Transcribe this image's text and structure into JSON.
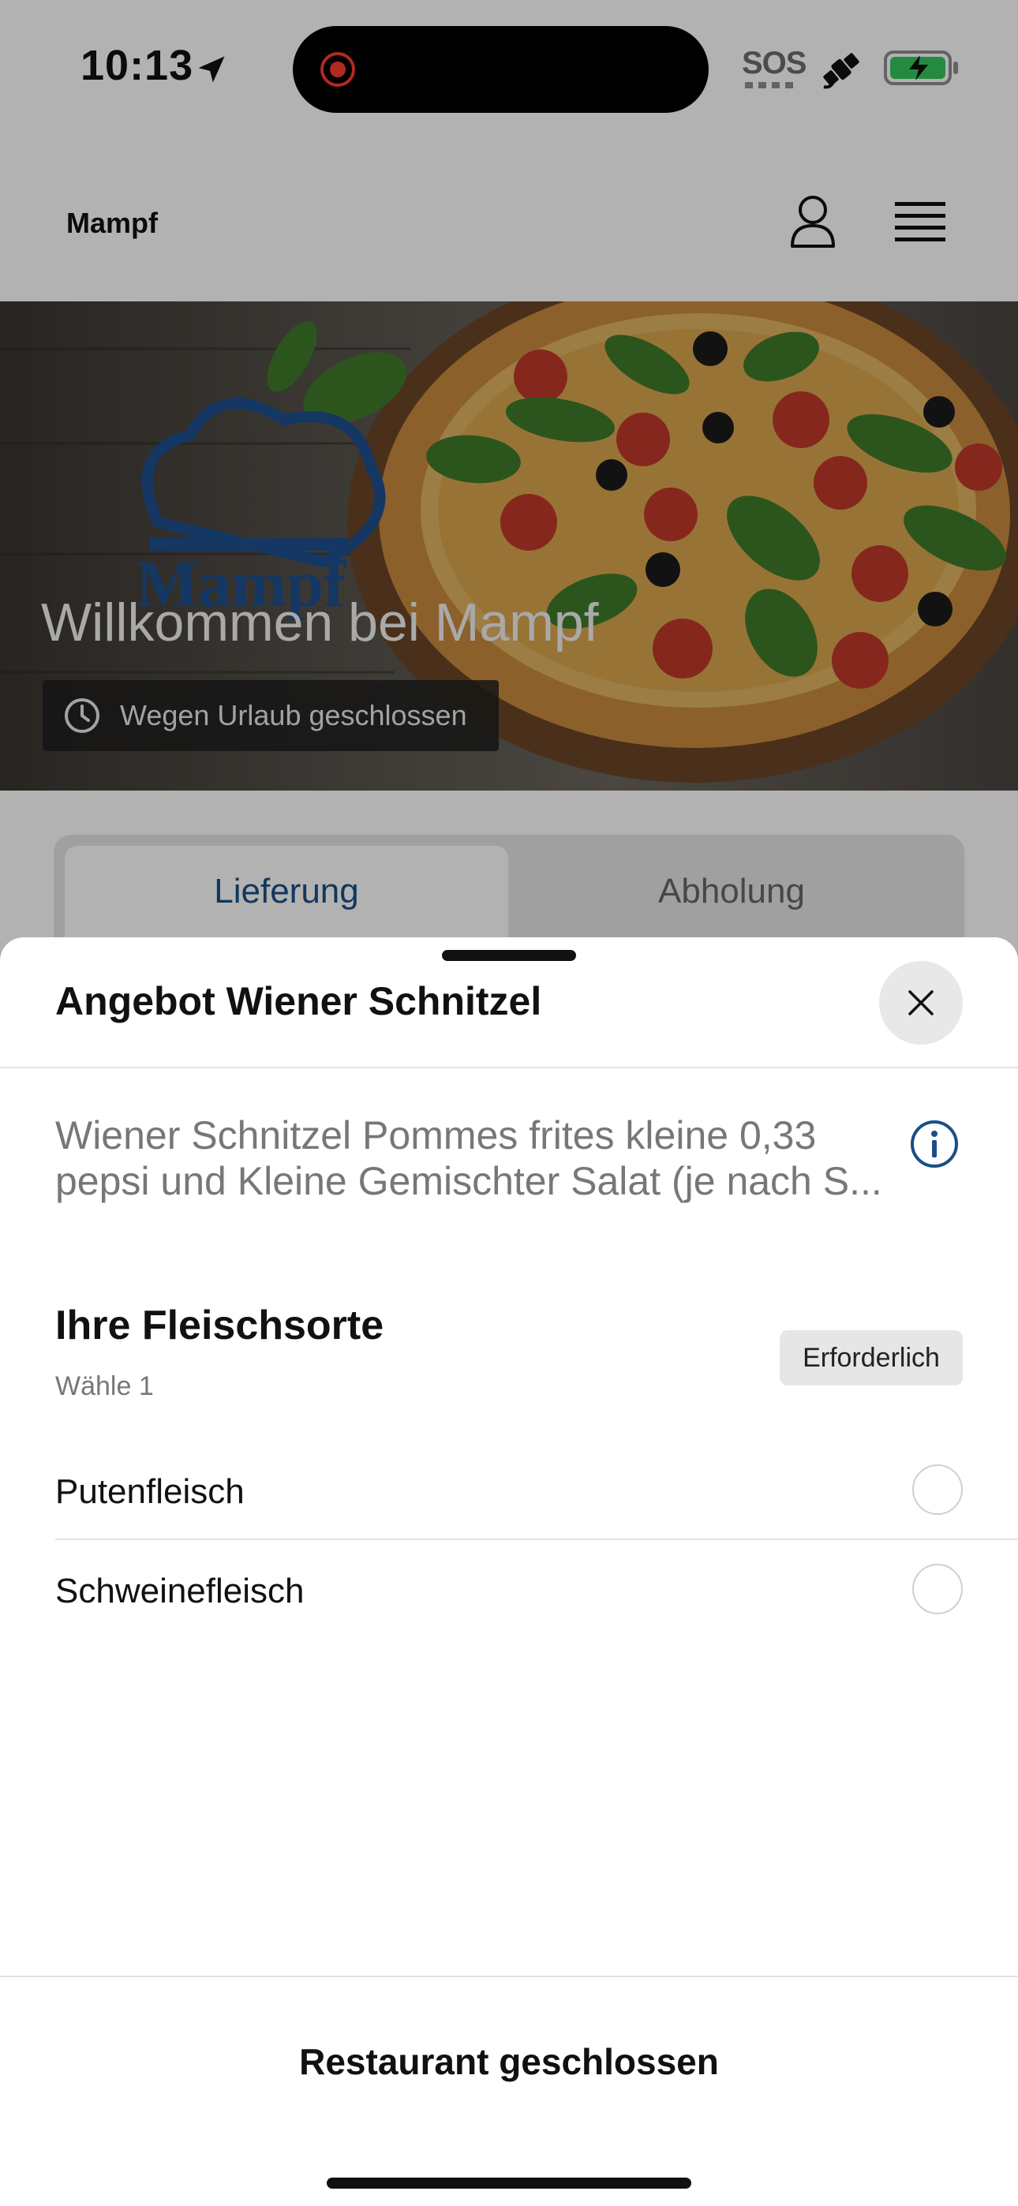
{
  "status_bar": {
    "time": "10:13",
    "sos": "SOS",
    "icons": [
      "location-arrow-icon",
      "recording-dot-icon",
      "satellite-icon",
      "battery-charging-icon"
    ]
  },
  "app_bar": {
    "brand": "Mampf",
    "icons": [
      "user-icon",
      "menu-icon"
    ]
  },
  "hero": {
    "logo_text": "Mampf",
    "title": "Willkommen bei Mampf",
    "status_chip": "Wegen Urlaub geschlossen"
  },
  "mode_tabs": {
    "items": [
      {
        "label": "Lieferung",
        "selected": true
      },
      {
        "label": "Abholung",
        "selected": false
      }
    ]
  },
  "sheet": {
    "title": "Angebot Wiener Schnitzel",
    "description": "Wiener Schnitzel Pommes frites kleine 0,33 pepsi und Kleine Gemischter Salat (je nach S...",
    "option_group": {
      "title": "Ihre Fleischsorte",
      "subtitle": "Wähle 1",
      "badge": "Erforderlich",
      "options": [
        {
          "label": "Putenfleisch",
          "selected": false
        },
        {
          "label": "Schweinefleisch",
          "selected": false
        }
      ]
    },
    "footer": "Restaurant geschlossen"
  },
  "colors": {
    "accent": "#1a4f86",
    "overlay": "rgba(0,0,0,0.3)",
    "battery": "#34c759"
  }
}
